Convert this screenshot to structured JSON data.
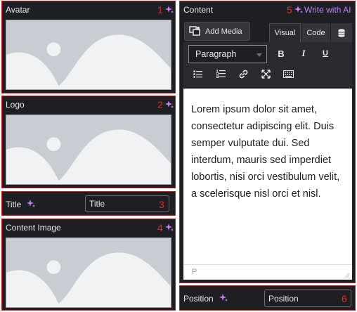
{
  "avatar": {
    "label": "Avatar",
    "number": "1",
    "icon": "ai-sparkle-icon"
  },
  "logo": {
    "label": "Logo",
    "number": "2",
    "icon": "ai-sparkle-icon"
  },
  "title_field": {
    "label": "Title",
    "value": "Title",
    "number": "3",
    "icon": "ai-sparkle-icon"
  },
  "content_image": {
    "label": "Content Image",
    "number": "4",
    "icon": "ai-sparkle-icon"
  },
  "content": {
    "label": "Content",
    "number": "5",
    "write_ai_label": "Write with AI",
    "add_media_label": "Add Media",
    "tabs": [
      "Visual",
      "Code"
    ],
    "format_select": "Paragraph",
    "toolbar_icons": [
      "bold-icon",
      "italic-icon",
      "underline-icon",
      "bullet-list-icon",
      "numbered-list-icon",
      "link-icon",
      "fullscreen-icon",
      "keyboard-icon"
    ],
    "text": "Lorem ipsum dolor sit amet, consectetur adipiscing elit. Duis semper vulputate dui. Sed interdum, mauris sed imperdiet lobortis, nisi orci vestibulum velit, a scelerisque nisl orci et nisl.",
    "status_path": "P"
  },
  "position_field": {
    "label": "Position",
    "value": "Position",
    "number": "6",
    "icon": "ai-sparkle-icon"
  },
  "colors": {
    "panel": "#1e1f22",
    "outline": "#d21a1a",
    "number": "#e02b2b",
    "ai_accent": "#c77dff",
    "placeholder": "#c8cdd3"
  }
}
